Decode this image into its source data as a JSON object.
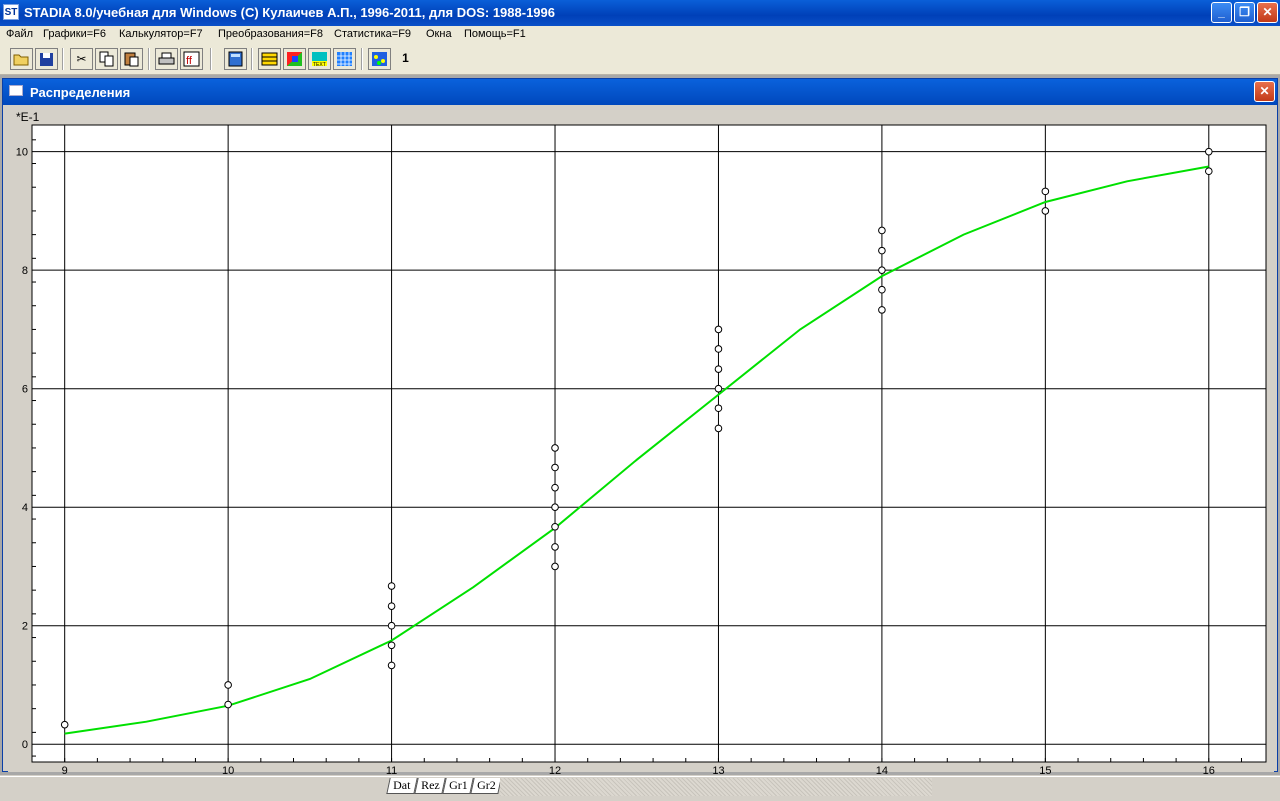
{
  "app": {
    "title": "STADIA 8.0/учебная для Windows  (C) Кулаичев А.П., 1996-2011, для DOS: 1988-1996",
    "icon_label": "ST"
  },
  "menu": {
    "file": "Файл",
    "charts": "Графики=F6",
    "calculator": "Калькулятор=F7",
    "transforms": "Преобразования=F8",
    "statistics": "Статистика=F9",
    "windows": "Окна",
    "help": "Помощь=F1"
  },
  "toolbar": {
    "icons": [
      "open-folder-icon",
      "save-disk-icon",
      "cut-scissors-icon",
      "copy-icon",
      "paste-icon",
      "print-icon",
      "font-icon",
      "calculator-icon",
      "table-icon",
      "graph-palette-icon",
      "text-icon",
      "grid-icon",
      "chart-editor-icon"
    ],
    "counter_label": "1"
  },
  "window": {
    "title": "Распределения"
  },
  "chart_data": {
    "type": "scatter",
    "title": "",
    "xlabel": "",
    "ylabel": "",
    "y_scale_note": "*E-1",
    "xlim": [
      8.8,
      16.35
    ],
    "ylim": [
      -0.3,
      10.45
    ],
    "x_ticks": [
      9,
      10,
      11,
      12,
      13,
      14,
      15,
      16
    ],
    "y_ticks": [
      0,
      2,
      4,
      6,
      8,
      10
    ],
    "grid": true,
    "colors": {
      "curve": "#00e000",
      "points": "#ffffff",
      "grid": "#000000",
      "background": "#ffffff"
    },
    "series": [
      {
        "kind": "points",
        "x": [
          9,
          10,
          10,
          11,
          11,
          11,
          11,
          11,
          12,
          12,
          12,
          12,
          12,
          12,
          12,
          13,
          13,
          13,
          13,
          13,
          13,
          14,
          14,
          14,
          14,
          14,
          15,
          15,
          16,
          16
        ],
        "y": [
          0.33,
          1.0,
          0.67,
          2.67,
          2.33,
          2.0,
          1.67,
          1.33,
          5.0,
          4.67,
          4.33,
          4.0,
          3.67,
          3.33,
          3.0,
          7.0,
          6.67,
          6.33,
          6.0,
          5.67,
          5.33,
          8.67,
          8.33,
          8.0,
          7.67,
          7.33,
          9.33,
          9.0,
          10.0,
          9.67
        ]
      },
      {
        "kind": "curve",
        "x": [
          9,
          9.5,
          10,
          10.5,
          11,
          11.5,
          12,
          12.5,
          13,
          13.5,
          14,
          14.5,
          15,
          15.5,
          16
        ],
        "y": [
          0.18,
          0.38,
          0.65,
          1.1,
          1.75,
          2.65,
          3.65,
          4.8,
          5.9,
          7.0,
          7.9,
          8.6,
          9.15,
          9.5,
          9.75
        ]
      }
    ]
  },
  "tabs": [
    "Dat",
    "Rez",
    "Gr1",
    "Gr2"
  ]
}
